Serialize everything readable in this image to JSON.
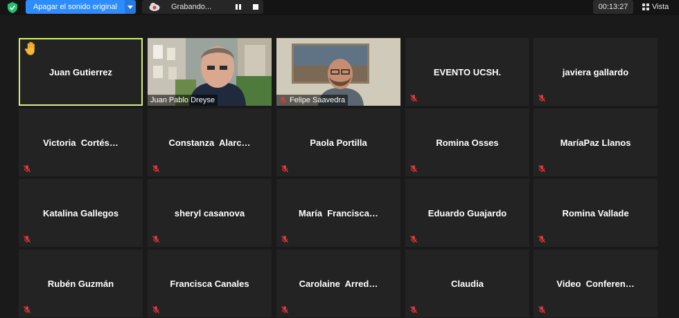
{
  "toolbar": {
    "mute_label": "Apagar el sonido original",
    "recording_label": "Grabando...",
    "timer": "00:13:27",
    "view_label": "Vista"
  },
  "participants": [
    {
      "name": "Juan Gutierrez"
    },
    {
      "name": "Juan Pablo Dreyse"
    },
    {
      "name": "Felipe Saavedra"
    },
    {
      "name": "EVENTO UCSH."
    },
    {
      "name": "javiera gallardo"
    },
    {
      "name": "Victoria  Cortés…"
    },
    {
      "name": "Constanza  Alarc…"
    },
    {
      "name": "Paola Portilla"
    },
    {
      "name": "Romina Osses"
    },
    {
      "name": "MaríaPaz Llanos"
    },
    {
      "name": "Katalina Gallegos"
    },
    {
      "name": "sheryl casanova"
    },
    {
      "name": "María  Francisca…"
    },
    {
      "name": "Eduardo Guajardo"
    },
    {
      "name": "Romina Vallade"
    },
    {
      "name": "Rubén Guzmán"
    },
    {
      "name": "Francisca Canales"
    },
    {
      "name": "Carolaine  Arred…"
    },
    {
      "name": "Claudia"
    },
    {
      "name": "Video  Conferen…"
    }
  ],
  "colors": {
    "accent": "#2d8cff",
    "active_speaker_border": "#d7f07a",
    "muted_mic": "#e0373a"
  }
}
